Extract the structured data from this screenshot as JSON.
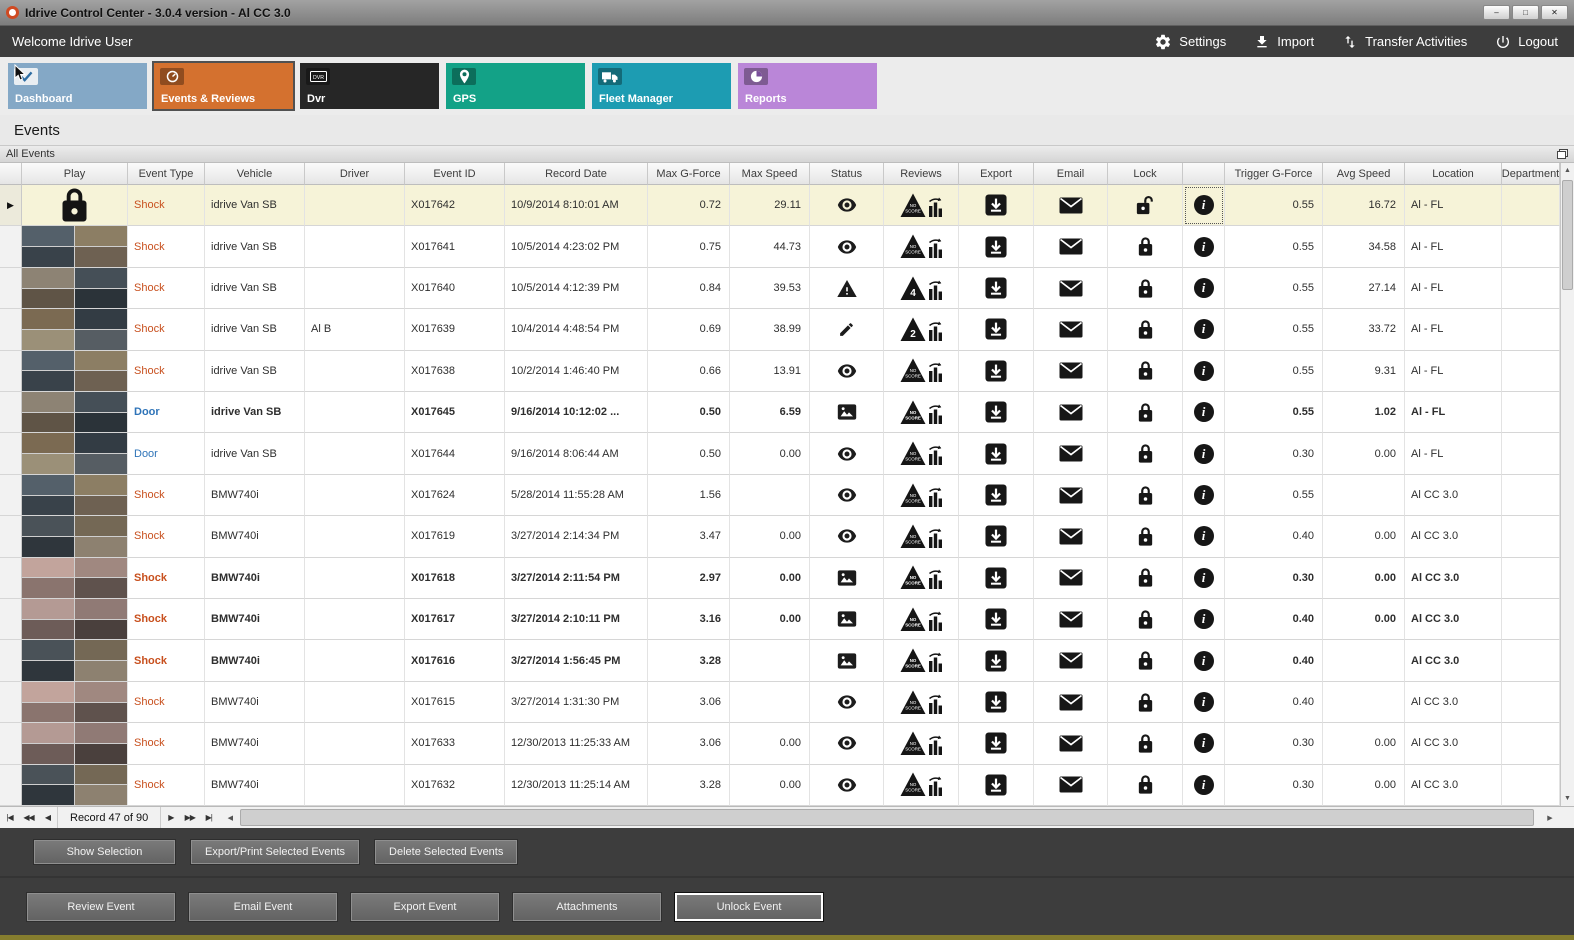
{
  "window": {
    "title": "Idrive Control Center - 3.0.4 version - Al CC 3.0",
    "controls": {
      "minimize": "–",
      "maximize": "□",
      "close": "✕"
    }
  },
  "topbar": {
    "welcome": "Welcome Idrive User",
    "actions": {
      "settings": "Settings",
      "import": "Import",
      "transfer": "Transfer Activities",
      "logout": "Logout"
    }
  },
  "tiles": [
    {
      "label": "Dashboard",
      "icon": "dashboard-check",
      "color": "#84a8c6",
      "selected": false
    },
    {
      "label": "Events & Reviews",
      "icon": "events-gauge",
      "color": "#d4712f",
      "selected": true
    },
    {
      "label": "Dvr",
      "icon": "dvr",
      "color": "#262626",
      "selected": false
    },
    {
      "label": "GPS",
      "icon": "gps-pin",
      "color": "#13a287",
      "selected": false
    },
    {
      "label": "Fleet Manager",
      "icon": "fleet-truck",
      "color": "#1d9cb2",
      "selected": false
    },
    {
      "label": "Reports",
      "icon": "reports-pie",
      "color": "#ba86d8",
      "selected": false
    }
  ],
  "page_title": "Events",
  "group_bar": "All Events",
  "grid": {
    "columns": [
      "",
      "Play",
      "Event Type",
      "Vehicle",
      "Driver",
      "Event ID",
      "Record Date",
      "Max G-Force",
      "Max Speed",
      "Status",
      "Reviews",
      "Export",
      "Email",
      "Lock",
      "",
      "Trigger G-Force",
      "Avg Speed",
      "Location",
      "Department"
    ],
    "rows": [
      {
        "type": "Shock",
        "vehicle": "idrive Van SB",
        "driver": "",
        "id": "X017642",
        "date": "10/9/2014 8:10:01 AM",
        "max_g": "0.72",
        "max_speed": "29.11",
        "status": "eye",
        "review": "NO SCORE",
        "trigger_g": "0.55",
        "avg_speed": "16.72",
        "location": "Al - FL",
        "bold": false,
        "selected": true,
        "play": "locked",
        "lock": "open",
        "info_focused": true
      },
      {
        "type": "Shock",
        "vehicle": "idrive Van SB",
        "driver": "",
        "id": "X017641",
        "date": "10/5/2014 4:23:02 PM",
        "max_g": "0.75",
        "max_speed": "44.73",
        "status": "eye",
        "review": "NO SCORE",
        "trigger_g": "0.55",
        "avg_speed": "34.58",
        "location": "Al - FL"
      },
      {
        "type": "Shock",
        "vehicle": "idrive Van SB",
        "driver": "",
        "id": "X017640",
        "date": "10/5/2014 4:12:39 PM",
        "max_g": "0.84",
        "max_speed": "39.53",
        "status": "warning",
        "review": "4",
        "trigger_g": "0.55",
        "avg_speed": "27.14",
        "location": "Al - FL"
      },
      {
        "type": "Shock",
        "vehicle": "idrive Van SB",
        "driver": "Al B",
        "id": "X017639",
        "date": "10/4/2014 4:48:54 PM",
        "max_g": "0.69",
        "max_speed": "38.99",
        "status": "edit",
        "review": "2",
        "trigger_g": "0.55",
        "avg_speed": "33.72",
        "location": "Al - FL"
      },
      {
        "type": "Shock",
        "vehicle": "idrive Van SB",
        "driver": "",
        "id": "X017638",
        "date": "10/2/2014 1:46:40 PM",
        "max_g": "0.66",
        "max_speed": "13.91",
        "status": "eye",
        "review": "NO SCORE",
        "trigger_g": "0.55",
        "avg_speed": "9.31",
        "location": "Al - FL"
      },
      {
        "type": "Door",
        "vehicle": "idrive Van SB",
        "driver": "",
        "id": "X017645",
        "date": "9/16/2014 10:12:02 ...",
        "max_g": "0.50",
        "max_speed": "6.59",
        "status": "snapshot",
        "review": "NO SCORE",
        "trigger_g": "0.55",
        "avg_speed": "1.02",
        "location": "Al - FL",
        "bold": true
      },
      {
        "type": "Door",
        "vehicle": "idrive Van SB",
        "driver": "",
        "id": "X017644",
        "date": "9/16/2014 8:06:44 AM",
        "max_g": "0.50",
        "max_speed": "0.00",
        "status": "eye",
        "review": "NO SCORE",
        "trigger_g": "0.30",
        "avg_speed": "0.00",
        "location": "Al - FL"
      },
      {
        "type": "Shock",
        "vehicle": "BMW740i",
        "driver": "",
        "id": "X017624",
        "date": "5/28/2014 11:55:28 AM",
        "max_g": "1.56",
        "max_speed": "",
        "status": "eye",
        "review": "NO SCORE",
        "trigger_g": "0.55",
        "avg_speed": "",
        "location": "Al CC 3.0"
      },
      {
        "type": "Shock",
        "vehicle": "BMW740i",
        "driver": "",
        "id": "X017619",
        "date": "3/27/2014 2:14:34 PM",
        "max_g": "3.47",
        "max_speed": "0.00",
        "status": "eye",
        "review": "NO SCORE",
        "trigger_g": "0.40",
        "avg_speed": "0.00",
        "location": "Al CC 3.0"
      },
      {
        "type": "Shock",
        "vehicle": "BMW740i",
        "driver": "",
        "id": "X017618",
        "date": "3/27/2014 2:11:54 PM",
        "max_g": "2.97",
        "max_speed": "0.00",
        "status": "snapshot",
        "review": "NO SCORE",
        "trigger_g": "0.30",
        "avg_speed": "0.00",
        "location": "Al CC 3.0",
        "bold": true
      },
      {
        "type": "Shock",
        "vehicle": "BMW740i",
        "driver": "",
        "id": "X017617",
        "date": "3/27/2014 2:10:11 PM",
        "max_g": "3.16",
        "max_speed": "0.00",
        "status": "snapshot",
        "review": "NO SCORE",
        "trigger_g": "0.40",
        "avg_speed": "0.00",
        "location": "Al CC 3.0",
        "bold": true
      },
      {
        "type": "Shock",
        "vehicle": "BMW740i",
        "driver": "",
        "id": "X017616",
        "date": "3/27/2014 1:56:45 PM",
        "max_g": "3.28",
        "max_speed": "",
        "status": "snapshot",
        "review": "NO SCORE",
        "trigger_g": "0.40",
        "avg_speed": "",
        "location": "Al CC 3.0",
        "bold": true
      },
      {
        "type": "Shock",
        "vehicle": "BMW740i",
        "driver": "",
        "id": "X017615",
        "date": "3/27/2014 1:31:30 PM",
        "max_g": "3.06",
        "max_speed": "",
        "status": "eye",
        "review": "NO SCORE",
        "trigger_g": "0.40",
        "avg_speed": "",
        "location": "Al CC 3.0"
      },
      {
        "type": "Shock",
        "vehicle": "BMW740i",
        "driver": "",
        "id": "X017633",
        "date": "12/30/2013 11:25:33 AM",
        "max_g": "3.06",
        "max_speed": "0.00",
        "status": "eye",
        "review": "NO SCORE",
        "trigger_g": "0.30",
        "avg_speed": "0.00",
        "location": "Al CC 3.0"
      },
      {
        "type": "Shock",
        "vehicle": "BMW740i",
        "driver": "",
        "id": "X017632",
        "date": "12/30/2013 11:25:14 AM",
        "max_g": "3.28",
        "max_speed": "0.00",
        "status": "eye",
        "review": "NO SCORE",
        "trigger_g": "0.30",
        "avg_speed": "0.00",
        "location": "Al CC 3.0"
      }
    ]
  },
  "pager": {
    "label": "Record 47 of 90",
    "nav_left": [
      "|◀",
      "◀◀",
      "◀"
    ],
    "nav_right": [
      "▶",
      "▶▶",
      "▶|"
    ]
  },
  "selection_actions": [
    "Show Selection",
    "Export/Print Selected Events",
    "Delete Selected Events"
  ],
  "event_actions": [
    "Review Event",
    "Email Event",
    "Export Event",
    "Attachments",
    "Unlock Event"
  ],
  "focused_action": "Unlock Event",
  "colors": {
    "shock_text": "#c8501e",
    "door_text": "#2f74b8",
    "selected_row_bg": "#f6f3d8",
    "accent_orange": "#d4712f"
  }
}
